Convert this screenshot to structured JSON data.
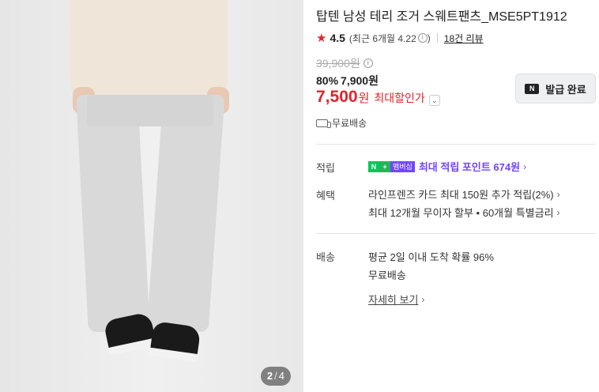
{
  "gallery": {
    "current_page": "2",
    "separator": "/",
    "total_pages": "4"
  },
  "product": {
    "title": "탑텐 남성 테리 조거 스웨트팬츠_MSE5PT1912",
    "rating": "4.5",
    "rating_note": "(최근 6개월 4.22",
    "rating_note_close": ")",
    "review_count": "18건 리뷰",
    "original_price": "39,900원",
    "discount_pct": "80%",
    "sale_price": "7,900원",
    "final_price": "7,500",
    "final_unit": "원",
    "max_discount_label": "최대할인가",
    "shipping_badge": "무료배송",
    "coupon_button": "발급 완료",
    "coupon_icon": "N"
  },
  "benefits": {
    "points_label": "적립",
    "npay_n": "N",
    "npay_plus": "+",
    "npay_member": "멤버십",
    "points_text": "최대 적립 포인트 674원",
    "benefit_label": "혜택",
    "benefit_line1": "라인프렌즈 카드 최대 150원 추가 적립(2%)",
    "benefit_line2": "최대 12개월 무이자 할부 • 60개월 특별금리"
  },
  "delivery": {
    "label": "배송",
    "line1": "평균 2일 이내 도착 확률 96%",
    "line2": "무료배송",
    "detail_link": "자세히 보기"
  },
  "colors": {
    "accent_red": "#e0242c",
    "npay_green": "#03c75a",
    "membership_purple": "#7146ff"
  },
  "icons": {
    "star": "star-icon",
    "info": "info-icon",
    "chevron_down": "chevron-down-icon",
    "chevron_right": "chevron-right-icon",
    "truck": "truck-icon",
    "coupon": "coupon-icon"
  }
}
